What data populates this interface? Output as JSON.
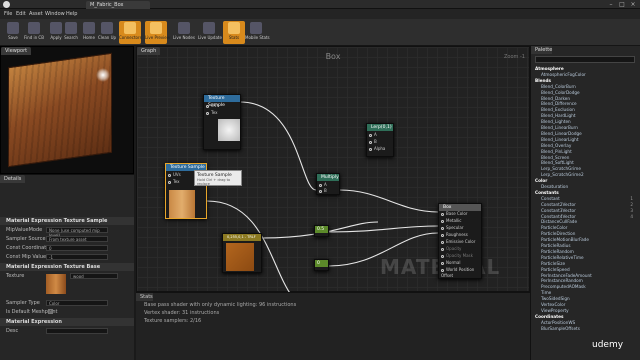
{
  "window": {
    "tab": "M_Fabric_Box"
  },
  "menu": [
    "File",
    "Edit",
    "Asset",
    "Window",
    "Help"
  ],
  "toolbar": [
    "Save",
    "Find in CB",
    "Apply",
    "Search",
    "Home",
    "Clean Up",
    "Connectors",
    "Live Preview",
    "Live Nodes",
    "Live Update",
    "Stats",
    "Mobile Stats"
  ],
  "viewport": {
    "tab": "Viewport"
  },
  "details": {
    "tab": "Details",
    "sec1": "Material Expression Texture Sample",
    "rows1": [
      [
        "MipValueMode",
        "None (use computed mip level)"
      ],
      [
        "Sampler Source",
        "From texture asset"
      ],
      [
        "Const Coordinate",
        "0"
      ],
      [
        "Const Mip Value",
        "-1"
      ]
    ],
    "sec2": "Material Expression Texture Base",
    "texture_label": "Texture",
    "texture_value": "wood",
    "rows2": [
      [
        "Sampler Type",
        "Color"
      ],
      [
        "Is Default Meshpaint",
        ""
      ]
    ],
    "sec3": "Material Expression",
    "desc_label": "Desc"
  },
  "graph": {
    "tab": "Graph",
    "title": "Box",
    "zoom": "Zoom -1",
    "watermark": "MATERIAL"
  },
  "nodes": {
    "ts1": {
      "title": "Texture Sample",
      "pins": [
        "UVs",
        "Tex"
      ]
    },
    "ts2": {
      "title": "Texture Sample",
      "pins": [
        "UVs",
        "Tex"
      ]
    },
    "lerp": {
      "title": "Lerp(0,1)",
      "pins": [
        "A",
        "B",
        "Alpha"
      ]
    },
    "mult": {
      "title": "Multiply",
      "pins": [
        "A",
        "B"
      ]
    },
    "color": {
      "title": "0,255,0,1 - TRLF"
    },
    "c1": {
      "title": "0.5"
    },
    "c2": {
      "title": "0"
    },
    "material": {
      "title": "Box",
      "pins": [
        "Base Color",
        "Metallic",
        "Specular",
        "Roughness",
        "Emissive Color",
        "Opacity",
        "Opacity Mask",
        "Normal",
        "World Position Offset"
      ]
    }
  },
  "tooltip": {
    "title": "Texture Sample",
    "sub": "Hold Ctrl + drag to replace"
  },
  "stats": {
    "tab": "Stats",
    "lines": [
      "Base pass shader with only dynamic lighting: 96 instructions",
      "Vertex shader: 31 instructions",
      "Texture samplers: 2/16"
    ]
  },
  "palette": {
    "tab": "Palette",
    "items": [
      {
        "t": "Atmosphere",
        "c": true
      },
      {
        "t": "AtmosphericFogColor"
      },
      {
        "t": "Blends",
        "c": true
      },
      {
        "t": "Blend_ColorBurn"
      },
      {
        "t": "Blend_ColorDodge"
      },
      {
        "t": "Blend_Darken"
      },
      {
        "t": "Blend_Difference"
      },
      {
        "t": "Blend_Exclusion"
      },
      {
        "t": "Blend_HardLight"
      },
      {
        "t": "Blend_Lighten"
      },
      {
        "t": "Blend_LinearBurn"
      },
      {
        "t": "Blend_LinearDodge"
      },
      {
        "t": "Blend_LinearLight"
      },
      {
        "t": "Blend_Overlay"
      },
      {
        "t": "Blend_PinLight"
      },
      {
        "t": "Blend_Screen"
      },
      {
        "t": "Blend_SoftLight"
      },
      {
        "t": "Lerp_ScratchGrime"
      },
      {
        "t": "Lerp_ScratchGrime2"
      },
      {
        "t": "Color",
        "c": true
      },
      {
        "t": "Desaturation"
      },
      {
        "t": "Constants",
        "c": true
      },
      {
        "t": "Constant",
        "n": "1"
      },
      {
        "t": "Constant2Vector",
        "n": "2"
      },
      {
        "t": "Constant3Vector",
        "n": "3"
      },
      {
        "t": "Constant4Vector",
        "n": "4"
      },
      {
        "t": "DistanceCullFade"
      },
      {
        "t": "ParticleColor"
      },
      {
        "t": "ParticleDirection"
      },
      {
        "t": "ParticleMotionBlurFade"
      },
      {
        "t": "ParticleRadius"
      },
      {
        "t": "ParticleRandom"
      },
      {
        "t": "ParticleRelativeTime"
      },
      {
        "t": "ParticleSize"
      },
      {
        "t": "ParticleSpeed"
      },
      {
        "t": "PerInstanceFadeAmount"
      },
      {
        "t": "PerInstanceRandom"
      },
      {
        "t": "PrecomputedAOMask"
      },
      {
        "t": "Time"
      },
      {
        "t": "TwoSidedSign"
      },
      {
        "t": "VertexColor"
      },
      {
        "t": "ViewProperty"
      },
      {
        "t": "Coordinates",
        "c": true
      },
      {
        "t": "ActorPositionWS"
      },
      {
        "t": "BlurSampleOffsets"
      }
    ]
  },
  "watermark": "udemy"
}
